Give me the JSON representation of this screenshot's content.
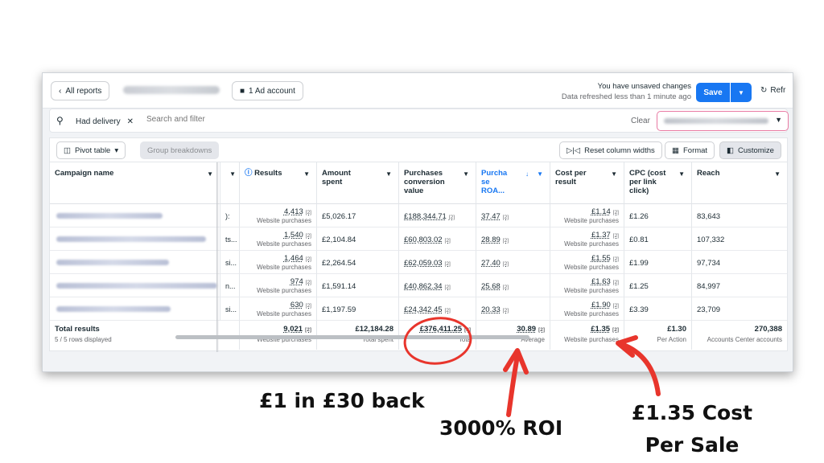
{
  "topbar": {
    "back_label": "All reports",
    "ad_account_label": "1 Ad account",
    "unsaved_line1": "You have unsaved changes",
    "unsaved_line2": "Data refreshed less than 1 minute ago",
    "save_label": "Save",
    "refresh_label": "Refr"
  },
  "search": {
    "chip_label": "Had delivery",
    "placeholder": "Search and filter",
    "clear_label": "Clear"
  },
  "toolbar": {
    "pivot_label": "Pivot table",
    "group_label": "Group breakdowns",
    "reset_label": "Reset column widths",
    "format_label": "Format",
    "customize_label": "Customize"
  },
  "table": {
    "headers": {
      "campaign": "Campaign name",
      "results": "Results",
      "amount": "Amount spent",
      "pcv": "Purchases conversion value",
      "roas": "Purcha se ROA...",
      "cpr": "Cost per result",
      "cpc": "CPC (cost per link click)",
      "reach": "Reach"
    },
    "rows": [
      {
        "col2": "):",
        "results": "4,413",
        "results_sub": "Website purchases",
        "amount": "£5,026.17",
        "pcv": "£188,344.71",
        "roas": "37.47",
        "cpr": "£1.14",
        "cpr_sub": "Website purchases",
        "cpc": "£1.26",
        "reach": "83,643"
      },
      {
        "col2": "ts...",
        "results": "1,540",
        "results_sub": "Website purchases",
        "amount": "£2,104.84",
        "pcv": "£60,803.02",
        "roas": "28.89",
        "cpr": "£1.37",
        "cpr_sub": "Website purchases",
        "cpc": "£0.81",
        "reach": "107,332"
      },
      {
        "col2": "si...",
        "results": "1,464",
        "results_sub": "Website purchases",
        "amount": "£2,264.54",
        "pcv": "£62,059.03",
        "roas": "27.40",
        "cpr": "£1.55",
        "cpr_sub": "Website purchases",
        "cpc": "£1.99",
        "reach": "97,734"
      },
      {
        "col2": "n...",
        "results": "974",
        "results_sub": "Website purchases",
        "amount": "£1,591.14",
        "pcv": "£40,862.34",
        "roas": "25.68",
        "cpr": "£1.63",
        "cpr_sub": "Website purchases",
        "cpc": "£1.25",
        "reach": "84,997"
      },
      {
        "col2": "si...",
        "results": "630",
        "results_sub": "Website purchases",
        "amount": "£1,197.59",
        "pcv": "£24,342.45",
        "roas": "20.33",
        "cpr": "£1.90",
        "cpr_sub": "Website purchases",
        "cpc": "£3.39",
        "reach": "23,709"
      }
    ],
    "flag": "[2]",
    "totals": {
      "label": "Total results",
      "sub": "5 / 5 rows displayed",
      "results": "9,021",
      "results_sub": "Website purchases",
      "amount": "£12,184.28",
      "amount_sub": "Total spent",
      "pcv": "£376,411.25",
      "pcv_sub": "Tota",
      "roas": "30.89",
      "roas_sub": "Average",
      "cpr": "£1.35",
      "cpr_sub": "Website purchases",
      "cpc": "£1.30",
      "cpc_sub": "Per Action",
      "reach": "270,388",
      "reach_sub": "Accounts Center accounts"
    }
  },
  "annotations": {
    "a1": "£1 in £30 back",
    "a2": "3000% ROI",
    "a3_line1": "£1.35 Cost",
    "a3_line2": "Per Sale",
    "accent": "#e8352c"
  }
}
